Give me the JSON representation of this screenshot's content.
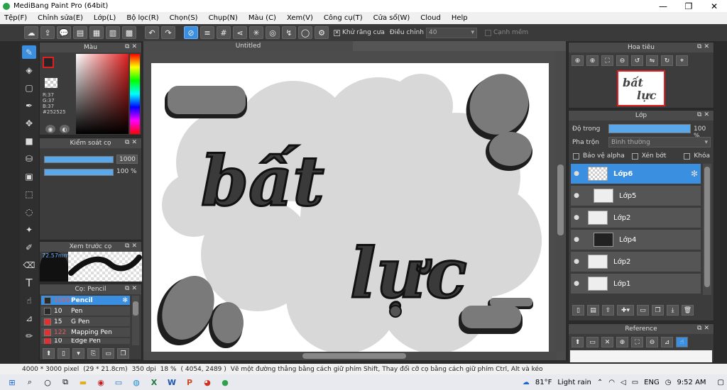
{
  "app": {
    "title": "MediBang Paint Pro (64bit)"
  },
  "menu": [
    "Tệp(F)",
    "Chỉnh sửa(E)",
    "Lớp(L)",
    "Bộ lọc(R)",
    "Chọn(S)",
    "Chụp(N)",
    "Màu (C)",
    "Xem(V)",
    "Công cụ(T)",
    "Cửa sổ(W)",
    "Cloud",
    "Help"
  ],
  "toolbar": {
    "antialias_label": "Khử răng cưa",
    "adjust_label": "Điều chỉnh",
    "adjust_value": "40",
    "smooth_label": "Cạnh mềm"
  },
  "color_panel": {
    "title": "Màu",
    "r": "R:37",
    "g": "G:37",
    "b": "B:37",
    "hex": "#252525"
  },
  "brush_control": {
    "title": "Kiểm soát cọ",
    "size": "1000",
    "opacity": "100 %"
  },
  "brush_preview": {
    "title": "Xem trước cọ",
    "size_label": "72.57mm"
  },
  "brushes": {
    "title": "Cọ: Pencil",
    "items": [
      {
        "size": "1000",
        "name": "Pencil",
        "color": "#2a2a2a"
      },
      {
        "size": "10",
        "name": "Pen",
        "color": "#2a2a2a"
      },
      {
        "size": "15",
        "name": "G Pen",
        "color": "#e03030"
      },
      {
        "size": "122",
        "name": "Mapping Pen",
        "color": "#e03030"
      },
      {
        "size": "10",
        "name": "Edge Pen",
        "color": "#e03030"
      }
    ]
  },
  "document": {
    "tab": "Untitled",
    "text_line1": "bất",
    "text_line2": "lực"
  },
  "navigator": {
    "title": "Hoa tiêu",
    "thumb_text1": "bất",
    "thumb_text2": "lực"
  },
  "layer_panel": {
    "title": "Lớp",
    "opacity_label": "Độ trong",
    "opacity_value": "100 %",
    "opacity_level": 1.0,
    "blend_label": "Pha trộn",
    "blend_value": "Bình thường",
    "protect_alpha": "Bảo vệ alpha",
    "clipping": "Xén bớt",
    "lock": "Khóa",
    "layers": [
      "Lớp6",
      "Lớp5",
      "Lớp2",
      "Lớp4",
      "Lớp2",
      "Lớp1"
    ]
  },
  "reference": {
    "title": "Reference"
  },
  "status": {
    "pixels": "4000 * 3000 pixel",
    "size_cm": "(29 * 21.8cm)",
    "dpi": "350 dpi",
    "zoom": "18 %",
    "coords": "( 4054, 2489 )",
    "hint": "Vẽ một đường thẳng bằng cách giữ phím Shift, Thay đổi cỡ cọ bằng cách giữ phím Ctrl, Alt và kéo"
  },
  "taskbar": {
    "temp": "81°F",
    "weather": "Light rain",
    "lang": "ENG",
    "time": "9:52 AM"
  }
}
